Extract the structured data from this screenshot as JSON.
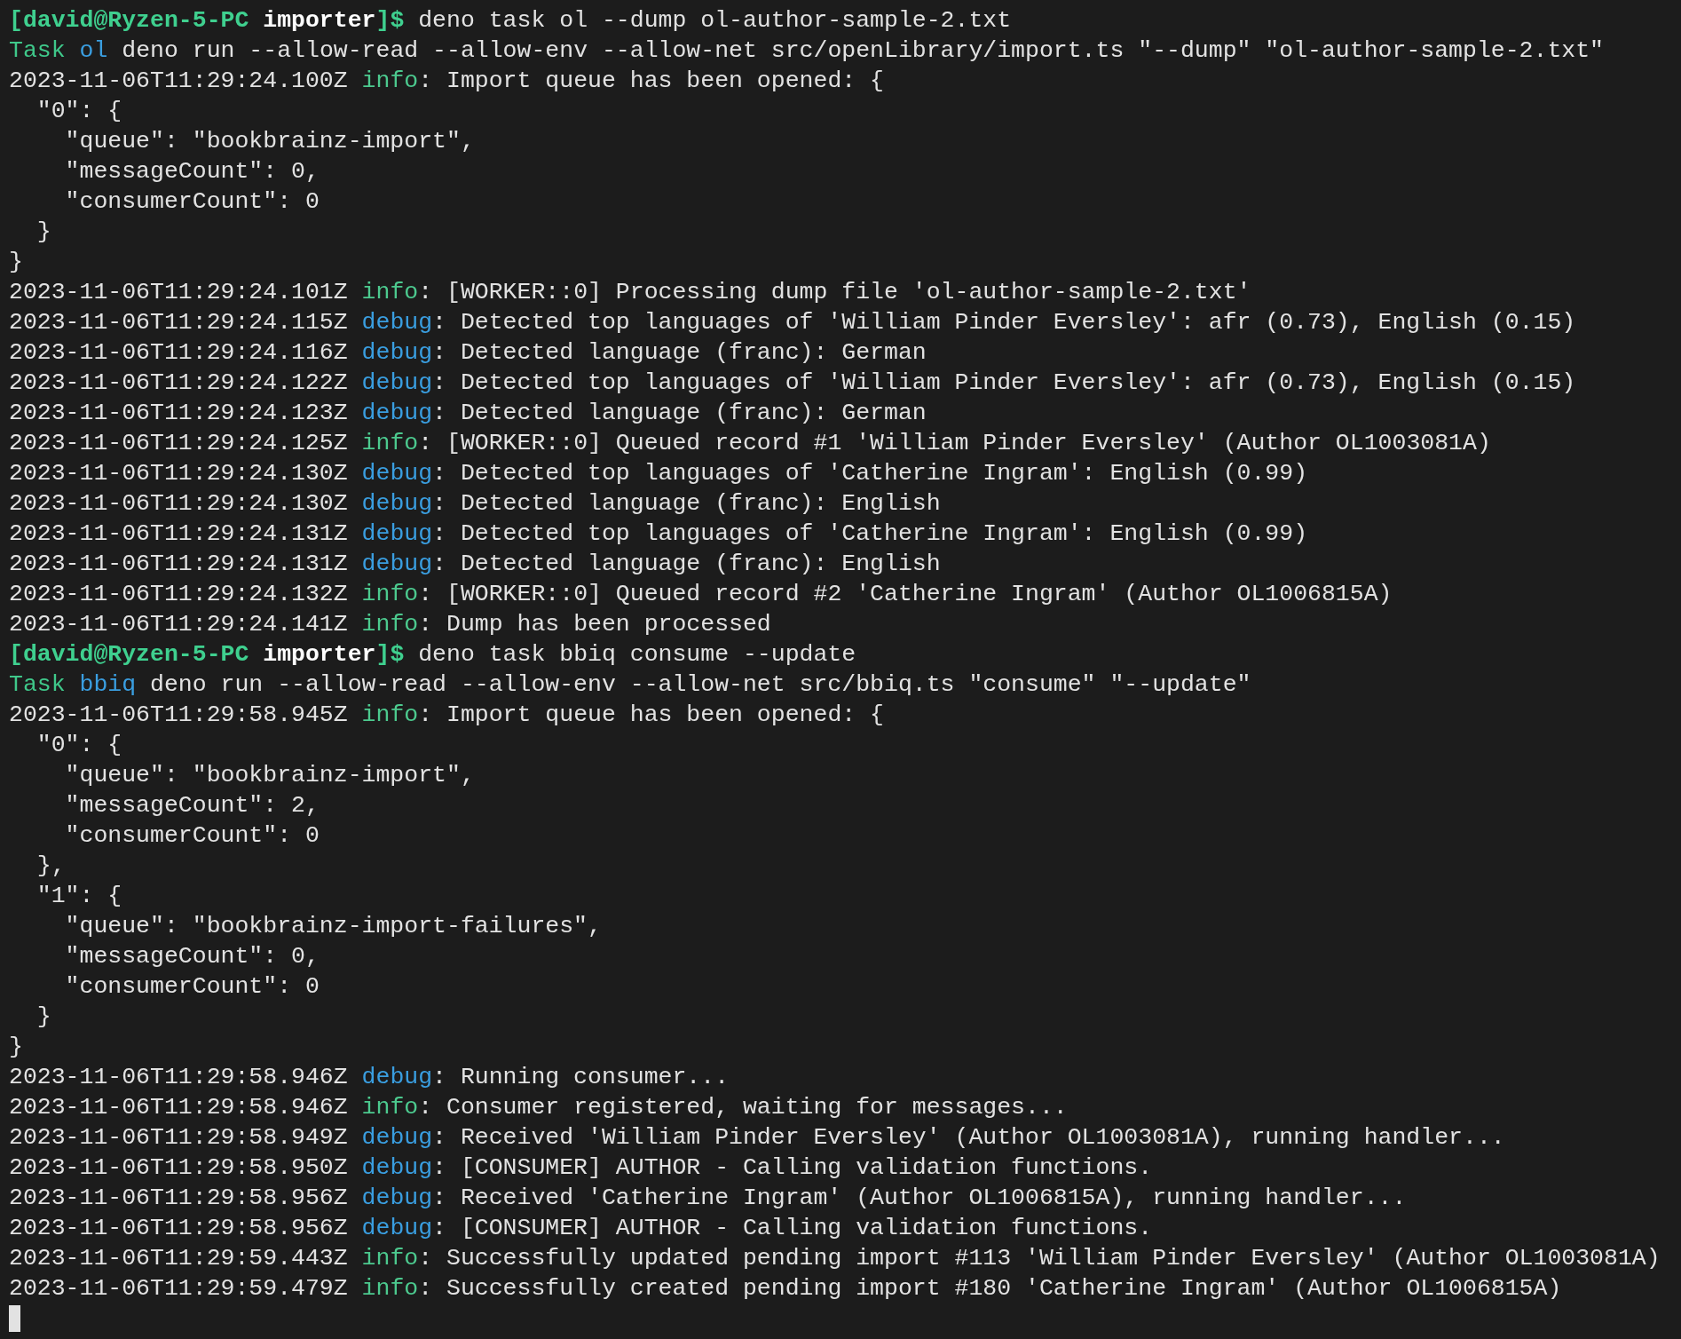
{
  "lines": [
    {
      "kind": "prompt",
      "user": "[david@Ryzen-5-PC",
      "dir": " importer",
      "close": "]$",
      "command": " deno task ol --dump ol-author-sample-2.txt"
    },
    {
      "kind": "task",
      "label": "Task",
      "name": " ol",
      "command": " deno run --allow-read --allow-env --allow-net src/openLibrary/import.ts \"--dump\" \"ol-author-sample-2.txt\""
    },
    {
      "kind": "log",
      "time": "2023-11-06T11:29:24.100Z ",
      "level": "info",
      "message": ": Import queue has been opened: {"
    },
    {
      "kind": "text",
      "text": "  \"0\": {"
    },
    {
      "kind": "text",
      "text": "    \"queue\": \"bookbrainz-import\","
    },
    {
      "kind": "text",
      "text": "    \"messageCount\": 0,"
    },
    {
      "kind": "text",
      "text": "    \"consumerCount\": 0"
    },
    {
      "kind": "text",
      "text": "  }"
    },
    {
      "kind": "text",
      "text": "}"
    },
    {
      "kind": "log",
      "time": "2023-11-06T11:29:24.101Z ",
      "level": "info",
      "message": ": [WORKER::0] Processing dump file 'ol-author-sample-2.txt'"
    },
    {
      "kind": "log",
      "time": "2023-11-06T11:29:24.115Z ",
      "level": "debug",
      "message": ": Detected top languages of 'William Pinder Eversley': afr (0.73), English (0.15)"
    },
    {
      "kind": "log",
      "time": "2023-11-06T11:29:24.116Z ",
      "level": "debug",
      "message": ": Detected language (franc): German"
    },
    {
      "kind": "log",
      "time": "2023-11-06T11:29:24.122Z ",
      "level": "debug",
      "message": ": Detected top languages of 'William Pinder Eversley': afr (0.73), English (0.15)"
    },
    {
      "kind": "log",
      "time": "2023-11-06T11:29:24.123Z ",
      "level": "debug",
      "message": ": Detected language (franc): German"
    },
    {
      "kind": "log",
      "time": "2023-11-06T11:29:24.125Z ",
      "level": "info",
      "message": ": [WORKER::0] Queued record #1 'William Pinder Eversley' (Author OL1003081A)"
    },
    {
      "kind": "log",
      "time": "2023-11-06T11:29:24.130Z ",
      "level": "debug",
      "message": ": Detected top languages of 'Catherine Ingram': English (0.99)"
    },
    {
      "kind": "log",
      "time": "2023-11-06T11:29:24.130Z ",
      "level": "debug",
      "message": ": Detected language (franc): English"
    },
    {
      "kind": "log",
      "time": "2023-11-06T11:29:24.131Z ",
      "level": "debug",
      "message": ": Detected top languages of 'Catherine Ingram': English (0.99)"
    },
    {
      "kind": "log",
      "time": "2023-11-06T11:29:24.131Z ",
      "level": "debug",
      "message": ": Detected language (franc): English"
    },
    {
      "kind": "log",
      "time": "2023-11-06T11:29:24.132Z ",
      "level": "info",
      "message": ": [WORKER::0] Queued record #2 'Catherine Ingram' (Author OL1006815A)"
    },
    {
      "kind": "log",
      "time": "2023-11-06T11:29:24.141Z ",
      "level": "info",
      "message": ": Dump has been processed"
    },
    {
      "kind": "prompt",
      "user": "[david@Ryzen-5-PC",
      "dir": " importer",
      "close": "]$",
      "command": " deno task bbiq consume --update"
    },
    {
      "kind": "task",
      "label": "Task",
      "name": " bbiq",
      "command": " deno run --allow-read --allow-env --allow-net src/bbiq.ts \"consume\" \"--update\""
    },
    {
      "kind": "log",
      "time": "2023-11-06T11:29:58.945Z ",
      "level": "info",
      "message": ": Import queue has been opened: {"
    },
    {
      "kind": "text",
      "text": "  \"0\": {"
    },
    {
      "kind": "text",
      "text": "    \"queue\": \"bookbrainz-import\","
    },
    {
      "kind": "text",
      "text": "    \"messageCount\": 2,"
    },
    {
      "kind": "text",
      "text": "    \"consumerCount\": 0"
    },
    {
      "kind": "text",
      "text": "  },"
    },
    {
      "kind": "text",
      "text": "  \"1\": {"
    },
    {
      "kind": "text",
      "text": "    \"queue\": \"bookbrainz-import-failures\","
    },
    {
      "kind": "text",
      "text": "    \"messageCount\": 0,"
    },
    {
      "kind": "text",
      "text": "    \"consumerCount\": 0"
    },
    {
      "kind": "text",
      "text": "  }"
    },
    {
      "kind": "text",
      "text": "}"
    },
    {
      "kind": "log",
      "time": "2023-11-06T11:29:58.946Z ",
      "level": "debug",
      "message": ": Running consumer..."
    },
    {
      "kind": "log",
      "time": "2023-11-06T11:29:58.946Z ",
      "level": "info",
      "message": ": Consumer registered, waiting for messages..."
    },
    {
      "kind": "log",
      "time": "2023-11-06T11:29:58.949Z ",
      "level": "debug",
      "message": ": Received 'William Pinder Eversley' (Author OL1003081A), running handler..."
    },
    {
      "kind": "log",
      "time": "2023-11-06T11:29:58.950Z ",
      "level": "debug",
      "message": ": [CONSUMER] AUTHOR - Calling validation functions."
    },
    {
      "kind": "log",
      "time": "2023-11-06T11:29:58.956Z ",
      "level": "debug",
      "message": ": Received 'Catherine Ingram' (Author OL1006815A), running handler..."
    },
    {
      "kind": "log",
      "time": "2023-11-06T11:29:58.956Z ",
      "level": "debug",
      "message": ": [CONSUMER] AUTHOR - Calling validation functions."
    },
    {
      "kind": "log",
      "time": "2023-11-06T11:29:59.443Z ",
      "level": "info",
      "message": ": Successfully updated pending import #113 'William Pinder Eversley' (Author OL1003081A)"
    },
    {
      "kind": "log",
      "time": "2023-11-06T11:29:59.479Z ",
      "level": "info",
      "message": ": Successfully created pending import #180 'Catherine Ingram' (Author OL1006815A)"
    }
  ]
}
